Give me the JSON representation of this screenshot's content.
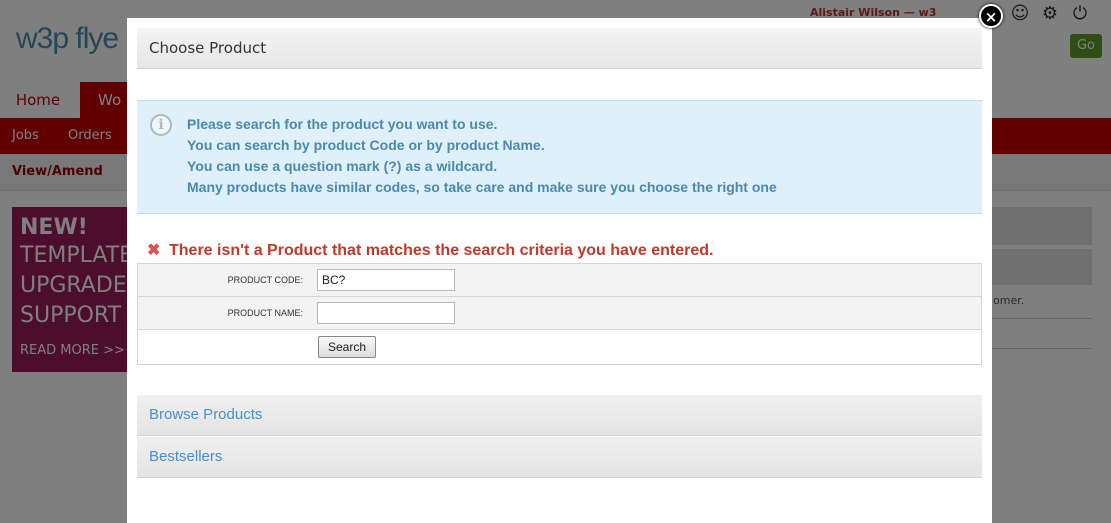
{
  "background": {
    "logo_text": "w3p flye",
    "user_text": "Alistair Wilson — w3",
    "go_label": "Go",
    "nav_home": "Home",
    "nav_active": "Wo",
    "subnav": [
      "Jobs",
      "Orders"
    ],
    "subsubnav": "View/Amend",
    "promo": [
      "NEW!",
      "TEMPLATE",
      "UPGRADE",
      "SUPPORT",
      "READ MORE >>"
    ],
    "right_text": "omer."
  },
  "modal": {
    "title": "Choose Product",
    "close_label": "×",
    "info_lines": [
      "Please search for the product you want to use.",
      "You can search by product Code or by product Name.",
      "You can use a question mark (?) as a wildcard.",
      "Many products have similar codes, so take care and make sure you choose the right one"
    ],
    "error": "There isn't a Product that matches the search criteria you have entered.",
    "form": {
      "code_label": "Product Code:",
      "code_value": "BC?",
      "name_label": "Product Name:",
      "name_value": "",
      "search_label": "Search"
    },
    "sections": [
      "Browse Products",
      "Bestsellers"
    ]
  },
  "colors": {
    "brand_red": "#c00000",
    "info_bg": "#dff0fa",
    "info_text": "#4a8aaa",
    "error_text": "#c0392b",
    "link_blue": "#4a8ed0"
  },
  "icons": {
    "info": "info-circle-icon",
    "error": "x-error-icon",
    "close": "close-icon",
    "gear": "gear-icon",
    "power": "power-icon"
  }
}
